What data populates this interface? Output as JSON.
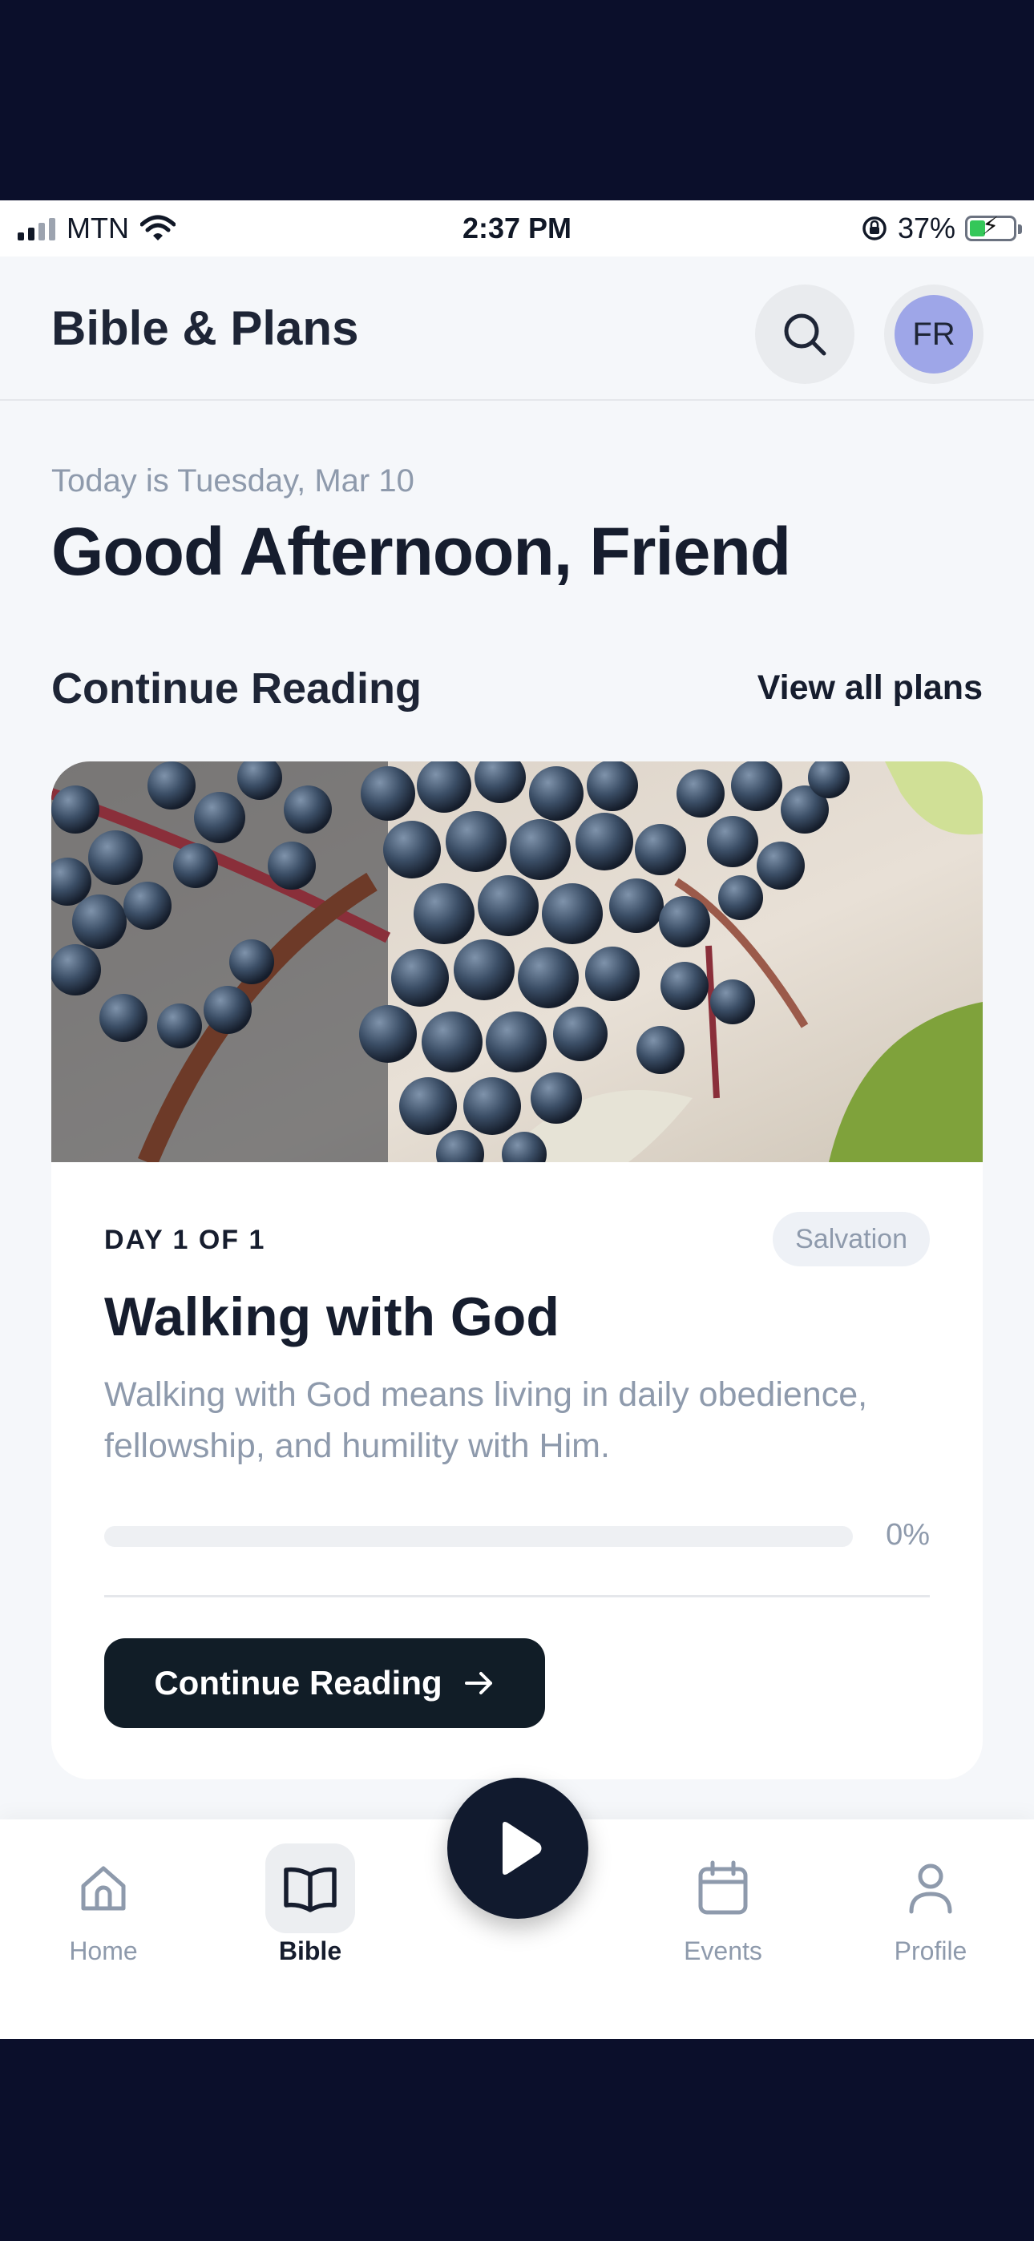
{
  "status_bar": {
    "carrier": "MTN",
    "time": "2:37 PM",
    "battery": "37%",
    "battery_level": 0.37
  },
  "header": {
    "title": "Bible & Plans",
    "avatar_initials": "FR"
  },
  "greeting": {
    "date": "Today is Tuesday, Mar 10",
    "message": "Good Afternoon, Friend"
  },
  "continue_section": {
    "title": "Continue Reading",
    "view_all": "View all plans"
  },
  "plan_card": {
    "day_label": "DAY 1 OF 1",
    "tag": "Salvation",
    "title": "Walking with God",
    "description": "Walking with God means living in daily obedience, fellowship, and humility with Him.",
    "progress_text": "0%",
    "progress_value": 0,
    "button_label": "Continue Reading"
  },
  "bottom_nav": {
    "items": [
      {
        "label": "Home",
        "icon": "home-icon"
      },
      {
        "label": "Bible",
        "icon": "book-icon",
        "active": true
      },
      {
        "label": "Events",
        "icon": "calendar-icon"
      },
      {
        "label": "Profile",
        "icon": "person-icon"
      }
    ]
  },
  "colors": {
    "outer_background": "#0b0f2b",
    "screen_background": "#f5f7fa",
    "primary_dark": "#111d27",
    "muted_text": "#8e9aac",
    "avatar": "#9ea6e8"
  }
}
